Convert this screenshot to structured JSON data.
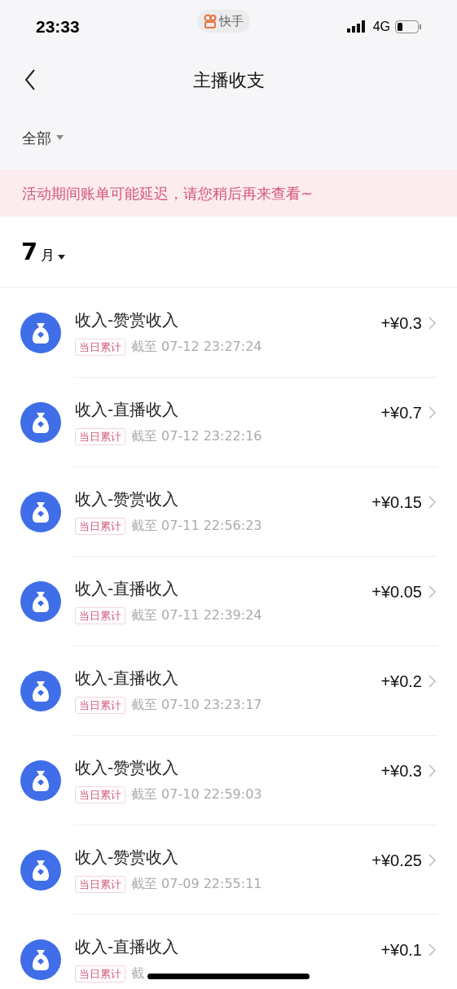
{
  "status_bar": {
    "time": "23:33",
    "app": "快手",
    "network": "4G"
  },
  "nav": {
    "title": "主播收支"
  },
  "filter": {
    "label": "全部"
  },
  "notice": "活动期间账单可能延迟，请您稍后再来查看~",
  "month": {
    "number": "7",
    "unit": "月"
  },
  "records": [
    {
      "title": "收入-赞赏收入",
      "tag": "当日累计",
      "time": "截至 07-12 23:27:24",
      "amount": "+¥0.3"
    },
    {
      "title": "收入-直播收入",
      "tag": "当日累计",
      "time": "截至 07-12 23:22:16",
      "amount": "+¥0.7"
    },
    {
      "title": "收入-赞赏收入",
      "tag": "当日累计",
      "time": "截至 07-11 22:56:23",
      "amount": "+¥0.15"
    },
    {
      "title": "收入-直播收入",
      "tag": "当日累计",
      "time": "截至 07-11 22:39:24",
      "amount": "+¥0.05"
    },
    {
      "title": "收入-直播收入",
      "tag": "当日累计",
      "time": "截至 07-10 23:23:17",
      "amount": "+¥0.2"
    },
    {
      "title": "收入-赞赏收入",
      "tag": "当日累计",
      "time": "截至 07-10 22:59:03",
      "amount": "+¥0.3"
    },
    {
      "title": "收入-赞赏收入",
      "tag": "当日累计",
      "time": "截至 07-09 22:55:11",
      "amount": "+¥0.25"
    },
    {
      "title": "收入-直播收入",
      "tag": "当日累计",
      "time": "截",
      "amount": "+¥0.1"
    }
  ]
}
